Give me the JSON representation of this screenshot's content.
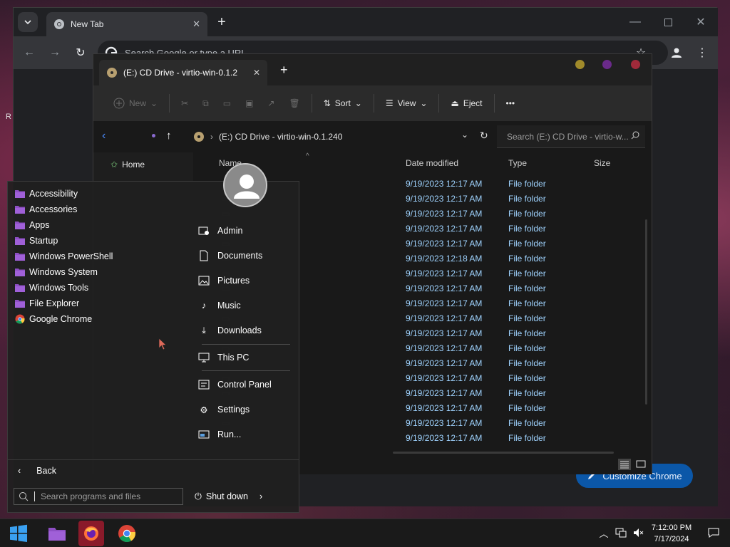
{
  "chrome": {
    "tab_title": "New Tab",
    "omnibox_placeholder": "Search Google or type a URL",
    "customize_label": "Customize Chrome"
  },
  "explorer": {
    "tab_title": "(E:) CD Drive - virtio-win-0.1.2",
    "commands": {
      "new": "New",
      "sort": "Sort",
      "view": "View",
      "eject": "Eject"
    },
    "breadcrumb": "(E:) CD Drive - virtio-win-0.1.240",
    "search_placeholder": "Search (E:) CD Drive - virtio-w...",
    "nav": {
      "home": "Home"
    },
    "columns": {
      "name": "Name",
      "date": "Date modified",
      "type": "Type",
      "size": "Size"
    },
    "rows": [
      {
        "date": "9/19/2023 12:17 AM",
        "type": "File folder"
      },
      {
        "date": "9/19/2023 12:17 AM",
        "type": "File folder"
      },
      {
        "date": "9/19/2023 12:17 AM",
        "type": "File folder"
      },
      {
        "date": "9/19/2023 12:17 AM",
        "type": "File folder"
      },
      {
        "date": "9/19/2023 12:17 AM",
        "type": "File folder"
      },
      {
        "date": "9/19/2023 12:18 AM",
        "type": "File folder"
      },
      {
        "date": "9/19/2023 12:17 AM",
        "type": "File folder"
      },
      {
        "date": "9/19/2023 12:17 AM",
        "type": "File folder"
      },
      {
        "date": "9/19/2023 12:17 AM",
        "type": "File folder"
      },
      {
        "date": "9/19/2023 12:17 AM",
        "type": "File folder"
      },
      {
        "date": "9/19/2023 12:17 AM",
        "type": "File folder"
      },
      {
        "date": "9/19/2023 12:17 AM",
        "type": "File folder"
      },
      {
        "date": "9/19/2023 12:17 AM",
        "type": "File folder"
      },
      {
        "date": "9/19/2023 12:17 AM",
        "type": "File folder"
      },
      {
        "date": "9/19/2023 12:17 AM",
        "type": "File folder"
      },
      {
        "date": "9/19/2023 12:17 AM",
        "type": "File folder"
      },
      {
        "date": "9/19/2023 12:17 AM",
        "type": "File folder"
      },
      {
        "date": "9/19/2023 12:17 AM",
        "type": "File folder"
      }
    ]
  },
  "start_menu": {
    "programs": [
      {
        "label": "Accessibility",
        "icon": "folder-icon"
      },
      {
        "label": "Accessories",
        "icon": "folder-icon"
      },
      {
        "label": "Apps",
        "icon": "folder-icon"
      },
      {
        "label": "Startup",
        "icon": "folder-icon"
      },
      {
        "label": "Windows PowerShell",
        "icon": "folder-icon"
      },
      {
        "label": "Windows System",
        "icon": "folder-icon"
      },
      {
        "label": "Windows Tools",
        "icon": "folder-icon"
      },
      {
        "label": "File Explorer",
        "icon": "file-explorer-icon"
      },
      {
        "label": "Google Chrome",
        "icon": "chrome-icon"
      }
    ],
    "right": {
      "admin": "Admin",
      "documents": "Documents",
      "pictures": "Pictures",
      "music": "Music",
      "downloads": "Downloads",
      "this_pc": "This PC",
      "control_panel": "Control Panel",
      "settings": "Settings",
      "run": "Run..."
    },
    "back_label": "Back",
    "search_placeholder": "Search programs and files",
    "shutdown_label": "Shut down"
  },
  "taskbar": {
    "time": "7:12:00 PM",
    "date": "7/17/2024"
  },
  "desktop": {
    "partial_text": "R"
  },
  "colors": {
    "accent_blue": "#0b57a8",
    "file_text": "#9fd3ff",
    "folder_purple": "#8e4fc4"
  }
}
